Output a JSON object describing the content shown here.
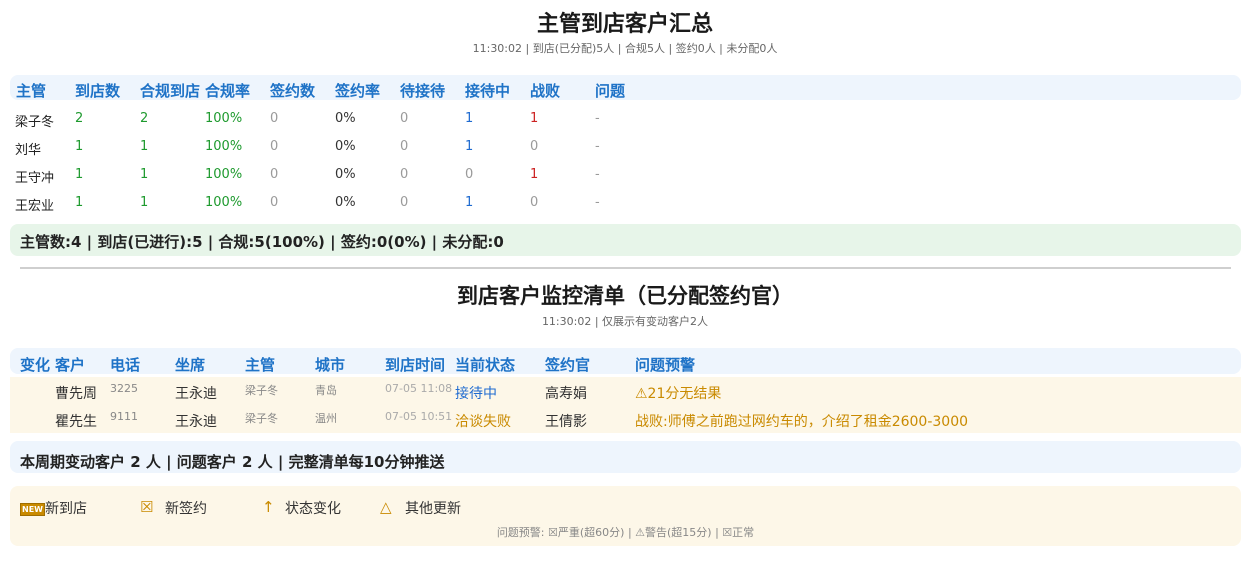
{
  "summary_section": {
    "title": "主管到店客户汇总",
    "subtitle": "11:30:02 | 到店(已分配)5人 | 合规5人 | 签约0人 | 未分配0人",
    "headers": [
      "主管",
      "到店数",
      "合规到店",
      "合规率",
      "签约数",
      "签约率",
      "待接待",
      "接待中",
      "战败",
      "问题"
    ],
    "rows": [
      {
        "name": "梁子冬",
        "arrive": "2",
        "compliant": "2",
        "rate": "100%",
        "signed": "0",
        "sign_rate": "0%",
        "waiting": "0",
        "serving": "1",
        "failed": "1",
        "issue": "-"
      },
      {
        "name": "刘华",
        "arrive": "1",
        "compliant": "1",
        "rate": "100%",
        "signed": "0",
        "sign_rate": "0%",
        "waiting": "0",
        "serving": "1",
        "failed": "0",
        "issue": "-"
      },
      {
        "name": "王守冲",
        "arrive": "1",
        "compliant": "1",
        "rate": "100%",
        "signed": "0",
        "sign_rate": "0%",
        "waiting": "0",
        "serving": "0",
        "failed": "1",
        "issue": "-"
      },
      {
        "name": "王宏业",
        "arrive": "1",
        "compliant": "1",
        "rate": "100%",
        "signed": "0",
        "sign_rate": "0%",
        "waiting": "0",
        "serving": "1",
        "failed": "0",
        "issue": "-"
      }
    ],
    "totals": "主管数:4 | 到店(已进行):5 | 合规:5(100%) | 签约:0(0%) | 未分配:0"
  },
  "monitor_section": {
    "title": "到店客户监控清单（已分配签约官）",
    "subtitle": "11:30:02 | 仅展示有变动客户2人",
    "headers": [
      "变化",
      "客户",
      "电话",
      "坐席",
      "主管",
      "城市",
      "到店时间",
      "当前状态",
      "签约官",
      "问题预警"
    ],
    "rows": [
      {
        "change": "",
        "customer": "曹先周",
        "phone": "3225",
        "agent": "王永迪",
        "supervisor": "梁子冬",
        "city": "青岛",
        "time": "07-05 11:08",
        "status": "接待中",
        "officer": "高寿娟",
        "warning": "⚠21分无结果"
      },
      {
        "change": "",
        "customer": "瞿先生",
        "phone": "9111",
        "agent": "王永迪",
        "supervisor": "梁子冬",
        "city": "温州",
        "time": "07-05 10:51",
        "status": "洽谈失败",
        "officer": "王倩影",
        "warning": "战败:师傅之前跑过网约车的，介绍了租金2600-3000"
      }
    ],
    "info": "本周期变动客户 2 人 | 问题客户 2 人 | 完整清单每10分钟推送"
  },
  "legend": {
    "items": [
      {
        "icon": "new-icon",
        "icon_text": "NEW",
        "label": "新到店"
      },
      {
        "icon": "cross-box-icon",
        "icon_text": "☒",
        "label": "新签约"
      },
      {
        "icon": "arrow-up-icon",
        "icon_text": "↑",
        "label": "状态变化"
      },
      {
        "icon": "triangle-icon",
        "icon_text": "△",
        "label": "其他更新"
      }
    ],
    "note": "问题预警: ☒严重(超60分) | ⚠警告(超15分) | ☒正常"
  },
  "colors": {
    "header_blue": "#1f73c7",
    "green": "#1e9a2e",
    "red": "#cc2222",
    "orange": "#c98a00",
    "blue_status": "#1f6bd0"
  }
}
